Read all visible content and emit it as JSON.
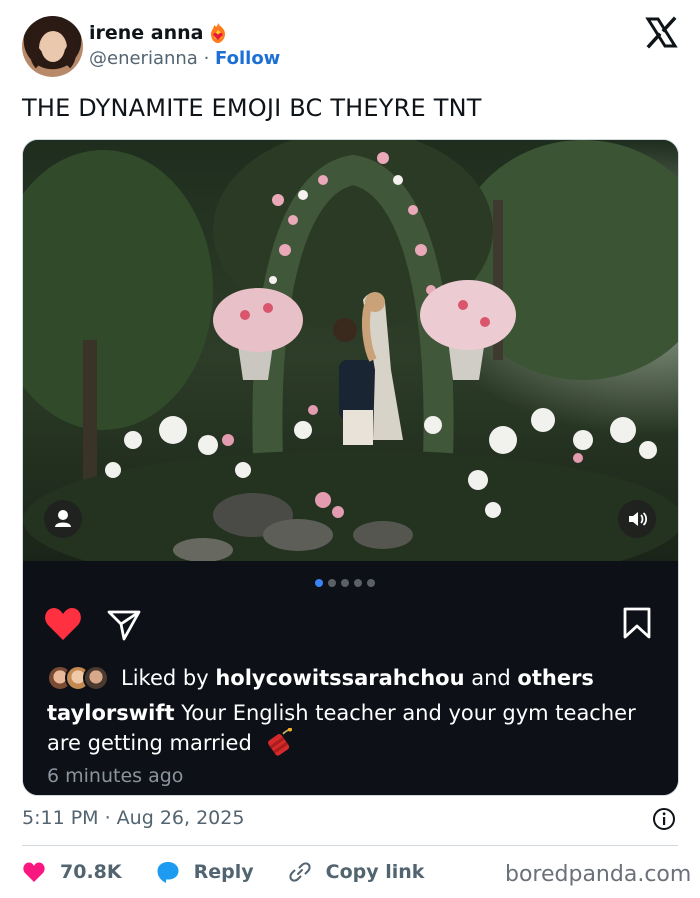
{
  "tweet": {
    "user_name": "irene anna",
    "handle": "@enerianna",
    "separator": "·",
    "follow_label": "Follow",
    "text": "THE DYNAMITE EMOJI BC THEYRE TNT",
    "timestamp": "5:11 PM · Aug 26, 2025"
  },
  "embedded_post": {
    "carousel_total": 5,
    "carousel_active_index": 0,
    "liked_by_prefix": "Liked by",
    "liked_by_user": "holycowitssarahchou",
    "liked_by_and": "and",
    "liked_by_others": "others",
    "caption_user": "taylorswift",
    "caption_text": "Your English teacher and your gym teacher are getting married",
    "time_ago": "6 minutes ago"
  },
  "actions": {
    "likes_count": "70.8K",
    "reply_label": "Reply",
    "copy_link_label": "Copy link"
  },
  "watermark": "boredpanda.com",
  "colors": {
    "follow": "#1d6fd6",
    "like_heart": "#f91880",
    "reply_bubble": "#1d9bf0",
    "ig_heart": "#ff3040",
    "panel_bg": "#0d1117"
  },
  "icons": [
    "x-logo-icon",
    "fire-heart-emoji-icon",
    "person-icon",
    "speaker-icon",
    "heart-icon",
    "send-icon",
    "bookmark-icon",
    "dynamite-emoji-icon",
    "info-icon",
    "reply-bubble-icon",
    "link-icon"
  ]
}
